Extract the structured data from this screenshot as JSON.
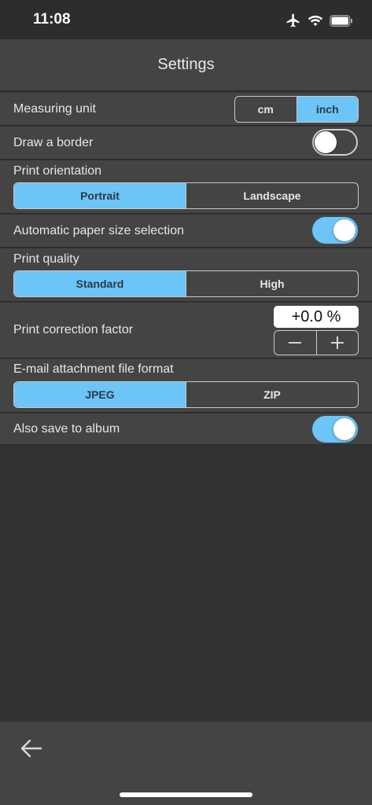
{
  "status_bar": {
    "time": "11:08",
    "icons": [
      "airplane-icon",
      "wifi-icon",
      "battery-icon"
    ]
  },
  "nav": {
    "title": "Settings"
  },
  "settings": {
    "measuring_unit": {
      "label": "Measuring unit",
      "options": [
        "cm",
        "inch"
      ],
      "selected": "inch"
    },
    "draw_border": {
      "label": "Draw a border",
      "on": false
    },
    "print_orientation": {
      "label": "Print orientation",
      "options": [
        "Portrait",
        "Landscape"
      ],
      "selected": "Portrait"
    },
    "auto_paper_size": {
      "label": "Automatic paper size selection",
      "on": true
    },
    "print_quality": {
      "label": "Print quality",
      "options": [
        "Standard",
        "High"
      ],
      "selected": "Standard"
    },
    "correction_factor": {
      "label": "Print correction factor",
      "value": "+0.0 %"
    },
    "attachment_format": {
      "label": "E-mail attachment file format",
      "options": [
        "JPEG",
        "ZIP"
      ],
      "selected": "JPEG"
    },
    "save_to_album": {
      "label": "Also save to album",
      "on": true
    }
  },
  "bottom_bar": {
    "back_icon": "back-arrow-icon"
  },
  "colors": {
    "accent": "#6cc4f7",
    "background": "#323232",
    "row_background": "#444444"
  }
}
